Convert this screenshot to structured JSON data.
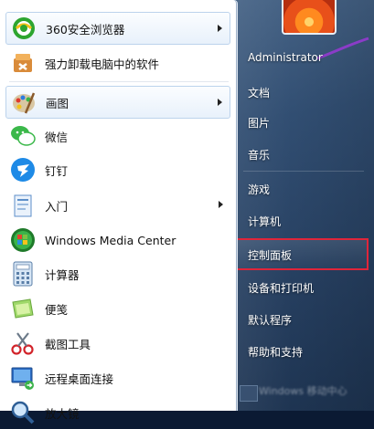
{
  "programs": [
    {
      "label": "360安全浏览器",
      "icon": "360-browser-icon",
      "has_submenu": true,
      "highlight": true
    },
    {
      "label": "强力卸载电脑中的软件",
      "icon": "uninstaller-box-icon",
      "has_submenu": false,
      "highlight": false
    },
    {
      "label": "画图",
      "icon": "paint-palette-icon",
      "has_submenu": true,
      "highlight": true
    },
    {
      "label": "微信",
      "icon": "wechat-icon",
      "has_submenu": false,
      "highlight": false
    },
    {
      "label": "钉钉",
      "icon": "dingtalk-icon",
      "has_submenu": false,
      "highlight": false
    },
    {
      "label": "入门",
      "icon": "getting-started-icon",
      "has_submenu": true,
      "highlight": false
    },
    {
      "label": "Windows Media Center",
      "icon": "windows-media-center-icon",
      "has_submenu": false,
      "highlight": false
    },
    {
      "label": "计算器",
      "icon": "calculator-icon",
      "has_submenu": false,
      "highlight": false
    },
    {
      "label": "便笺",
      "icon": "sticky-notes-icon",
      "has_submenu": false,
      "highlight": false
    },
    {
      "label": "截图工具",
      "icon": "snipping-tool-icon",
      "has_submenu": false,
      "highlight": false
    },
    {
      "label": "远程桌面连接",
      "icon": "remote-desktop-icon",
      "has_submenu": false,
      "highlight": false
    },
    {
      "label": "放大镜",
      "icon": "magnifier-icon",
      "has_submenu": false,
      "highlight": false
    }
  ],
  "user": {
    "name": "Administrator",
    "top_label": "游戏"
  },
  "right_links": {
    "documents": "文档",
    "pictures": "图片",
    "music": "音乐",
    "games": "游戏",
    "computer": "计算机",
    "control_panel": "控制面板",
    "devices_printers": "设备和打印机",
    "default_programs": "默认程序",
    "help_support": "帮助和支持"
  },
  "bottom_blurred": "Windows 移动中心",
  "colors": {
    "selection_border": "#e0253a",
    "pane_dark": "#263f60"
  }
}
